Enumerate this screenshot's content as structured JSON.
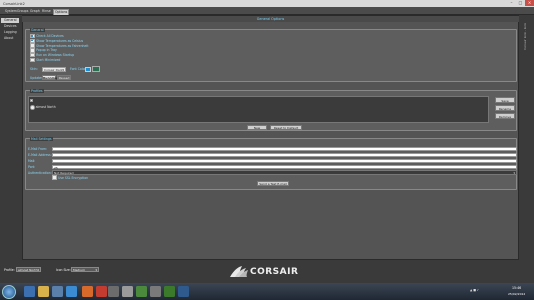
{
  "window": {
    "title": "CorsairLink2"
  },
  "menu": {
    "tabs": [
      "System",
      "Groups",
      "Graph",
      "Rinse",
      "Options"
    ],
    "active": "Options"
  },
  "sidebar": {
    "items": [
      "General",
      "Devices",
      "Logging",
      "About"
    ],
    "active": "General"
  },
  "main": {
    "header": "General Options"
  },
  "general": {
    "title": "General",
    "checkboxes": [
      {
        "label": "Check All Devices",
        "checked": true
      },
      {
        "label": "Show Temperatures as Celsius",
        "checked": true
      },
      {
        "label": "Show Temperatures as Fahrenheit",
        "checked": false
      },
      {
        "label": "Popup in Tray",
        "checked": false
      },
      {
        "label": "Run on Windows Startup",
        "checked": false
      },
      {
        "label": "Start Minimized",
        "checked": false
      }
    ],
    "skin_label": "Skin:",
    "skin_value": "Corsair Dark",
    "font_color_label": "Font Color:",
    "font_color_hex": "#1d8fd0",
    "updates_label": "Updates:",
    "updates_running": "Running",
    "updates_paused": "Paused"
  },
  "profiles": {
    "title": "Profiles",
    "items": [
      "almost North"
    ],
    "save": "Save",
    "rename": "Rename",
    "remove": "Remove",
    "new": "New",
    "reset": "Reset to Default"
  },
  "mail": {
    "title": "Mail Settings",
    "fields": [
      {
        "label": "E-Mail From:",
        "value": ""
      },
      {
        "label": "E-Mail Address:",
        "value": ""
      },
      {
        "label": "Mail:",
        "value": ""
      },
      {
        "label": "Port:",
        "value": "25"
      }
    ],
    "auth_label": "Authentication:",
    "auth_value": "Not Required",
    "ssl_label": "Use SSL Encryption",
    "send_test": "Send a Test E-mail"
  },
  "right_strip": {
    "text": "Corsair Link - Link"
  },
  "statusbar": {
    "profile_label": "Profile:",
    "profile_value": "almost North",
    "scale_label": "Icon Size:",
    "scale_value": "Medium"
  },
  "brand": {
    "logo_text": "CORSAIR"
  },
  "taskbar": {
    "time": "15:46",
    "date": "25/02/2012"
  }
}
